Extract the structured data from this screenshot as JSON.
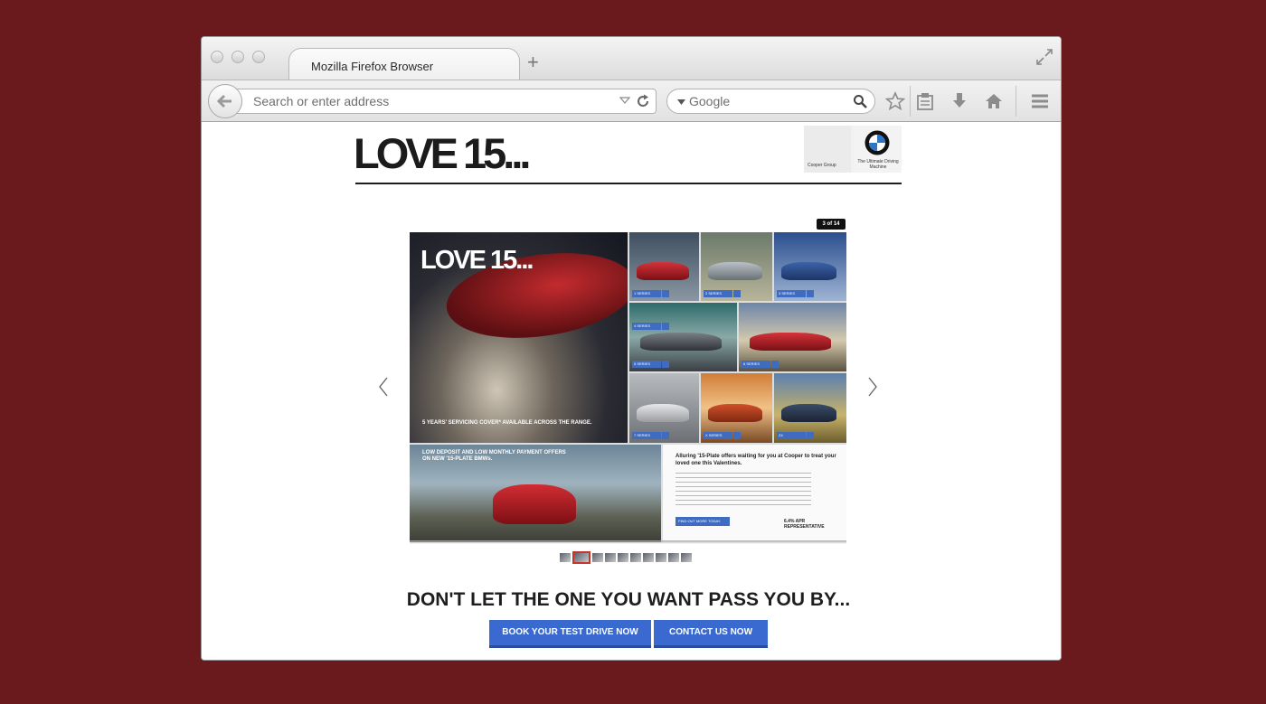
{
  "browser": {
    "tab_title": "Mozilla Firefox Browser",
    "url_placeholder": "Search or enter address",
    "search_engine": "Google"
  },
  "site": {
    "logo_text": "LOVE 15...",
    "dealer_name": "Cooper Group",
    "brand_tagline": "The Ultimate Driving Machine",
    "page_indicator": "3 of 14",
    "slide": {
      "hero_title": "LOVE 15...",
      "hero_caption": "5 YEARS' SERVICING COVER* AVAILABLE ACROSS THE RANGE.",
      "models": [
        "1 SERIES",
        "2 SERIES",
        "3 SERIES",
        "4 SERIES",
        "5 SERIES",
        "6 SERIES",
        "7 SERIES",
        "X SERIES",
        "Z4"
      ],
      "promo_title": "LOW DEPOSIT AND LOW MONTHLY PAYMENT OFFERS ON NEW '15-PLATE BMWs.",
      "offer_title": "Alluring '15-Plate offers waiting for you at Cooper to treat your loved one this Valentines.",
      "offer_button": "FIND OUT MORE TODAY.",
      "offer_apr": "6.4% APR REPRESENTATIVE"
    },
    "thumbnail_count": 10,
    "active_thumbnail": 2,
    "tagline": "DON'T LET THE ONE YOU WANT PASS YOU BY...",
    "cta_test_drive": "BOOK YOUR TEST DRIVE NOW",
    "cta_contact": "CONTACT US NOW"
  },
  "colors": {
    "backdrop": "#6a191c",
    "cta_blue": "#3a6ad0",
    "thumb_active": "#c5372c"
  }
}
